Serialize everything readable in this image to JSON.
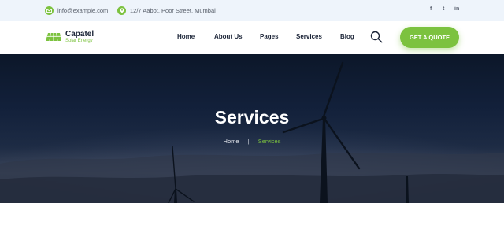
{
  "topbar": {
    "email": "info@example.com",
    "address": "12/7 Aabot, Poor Street, Mumbai",
    "social": [
      "facebook-icon",
      "twitter-icon",
      "linkedin-icon"
    ],
    "social_glyphs": {
      "facebook": "f",
      "twitter": "t",
      "linkedin": "in"
    }
  },
  "logo": {
    "name": "Capatel",
    "tagline": "Solar Energy"
  },
  "nav": {
    "items": [
      "Home",
      "About Us",
      "Pages",
      "Services",
      "Blog"
    ],
    "cta": "GET A QUOTE"
  },
  "hero": {
    "title": "Services",
    "breadcrumb": {
      "home": "Home",
      "separator": "|",
      "current": "Services"
    }
  },
  "colors": {
    "accent": "#7cc23f",
    "navy": "#1b2437",
    "topbar_bg": "#eef4fb"
  }
}
